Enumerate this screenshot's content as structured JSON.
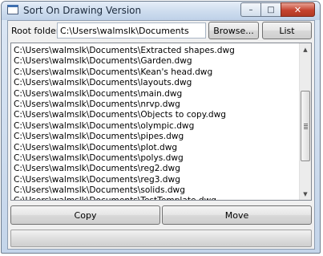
{
  "window": {
    "title": "Sort On Drawing Version",
    "caption_buttons": {
      "minimize": "–",
      "maximize": "□",
      "close": "✕"
    }
  },
  "root_folder": {
    "label": "Root folder:",
    "value": "C:\\Users\\walmslk\\Documents"
  },
  "buttons": {
    "browse": "Browse...",
    "list": "List",
    "copy": "Copy",
    "move": "Move"
  },
  "files": [
    "C:\\Users\\walmslk\\Documents\\Extracted shapes.dwg",
    "C:\\Users\\walmslk\\Documents\\Garden.dwg",
    "C:\\Users\\walmslk\\Documents\\Kean's head.dwg",
    "C:\\Users\\walmslk\\Documents\\layouts.dwg",
    "C:\\Users\\walmslk\\Documents\\main.dwg",
    "C:\\Users\\walmslk\\Documents\\nrvp.dwg",
    "C:\\Users\\walmslk\\Documents\\Objects to copy.dwg",
    "C:\\Users\\walmslk\\Documents\\olympic.dwg",
    "C:\\Users\\walmslk\\Documents\\pipes.dwg",
    "C:\\Users\\walmslk\\Documents\\plot.dwg",
    "C:\\Users\\walmslk\\Documents\\polys.dwg",
    "C:\\Users\\walmslk\\Documents\\reg2.dwg",
    "C:\\Users\\walmslk\\Documents\\reg3.dwg",
    "C:\\Users\\walmslk\\Documents\\solids.dwg",
    "C:\\Users\\walmslk\\Documents\\TestTemplate.dwg"
  ],
  "scrollbar": {
    "up_icon": "scroll-up-arrow",
    "down_icon": "scroll-down-arrow"
  },
  "progress": {
    "fraction": 0
  }
}
